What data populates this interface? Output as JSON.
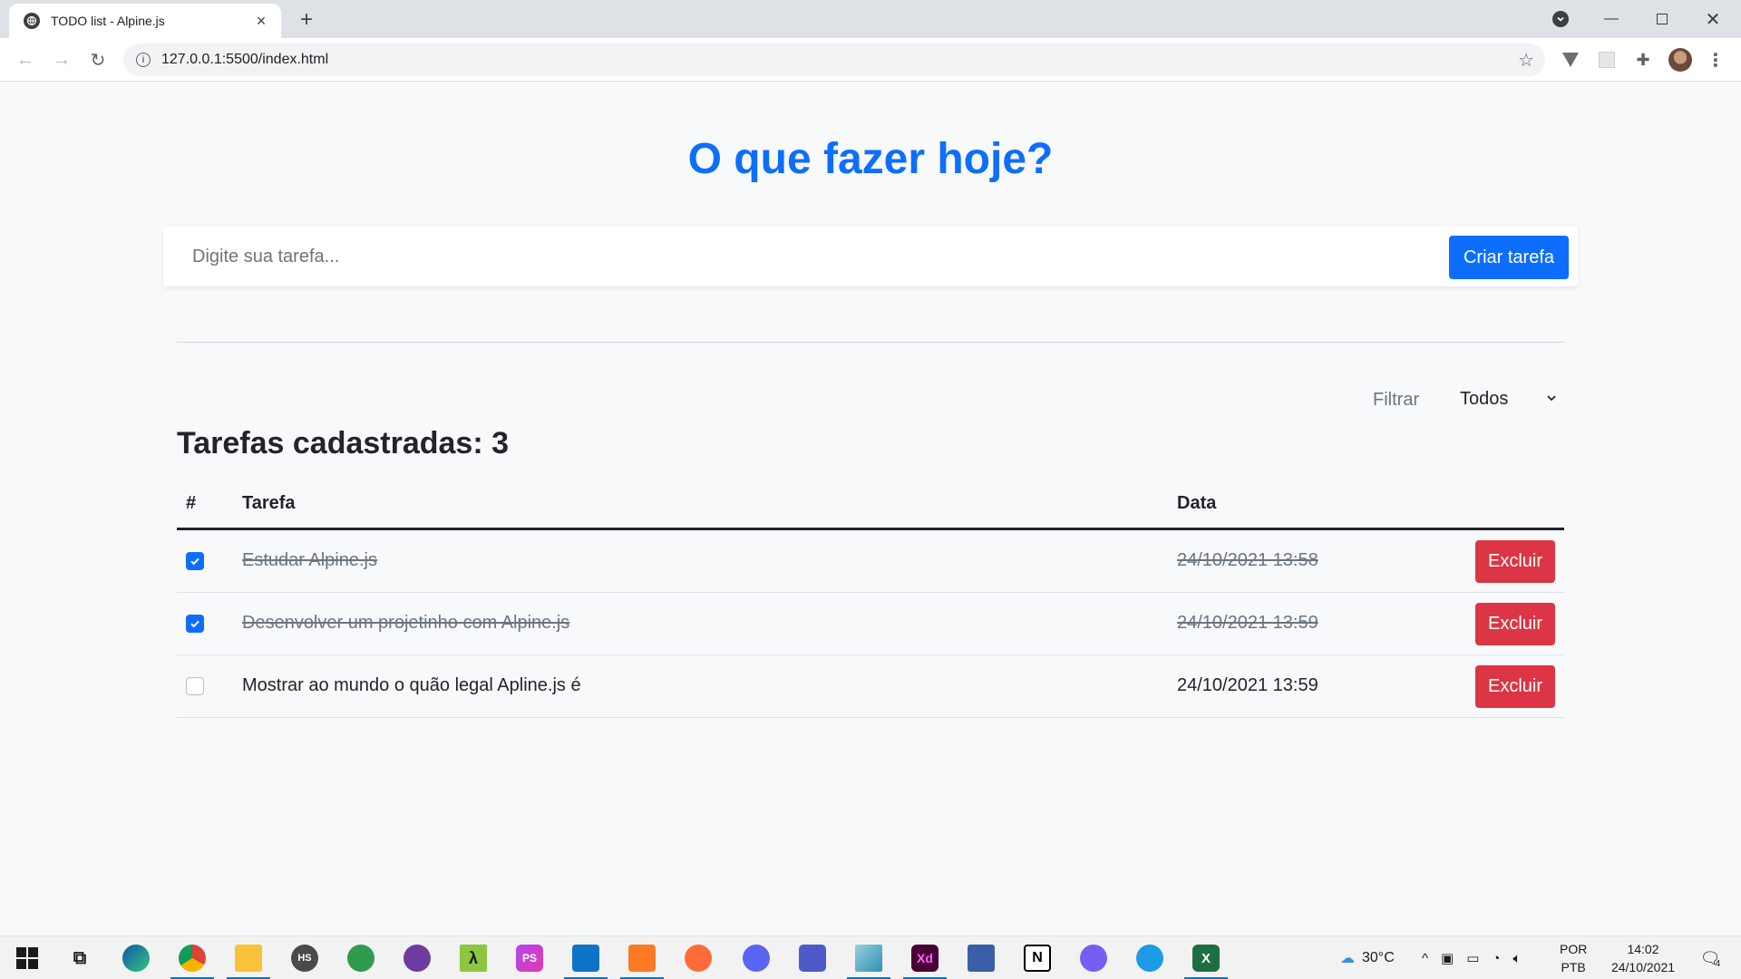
{
  "browser": {
    "tab_title": "TODO list - Alpine.js",
    "url": "127.0.0.1:5500/index.html"
  },
  "page": {
    "title": "O que fazer hoje?",
    "input_placeholder": "Digite sua tarefa...",
    "input_value": "",
    "create_button": "Criar tarefa",
    "filter_label": "Filtrar",
    "filter_value": "Todos",
    "count_heading": "Tarefas cadastradas: 3",
    "table": {
      "headers": [
        "#",
        "Tarefa",
        "Data"
      ],
      "rows": [
        {
          "checked": true,
          "task": "Estudar Alpine.js",
          "date": "24/10/2021 13:58",
          "delete": "Excluir"
        },
        {
          "checked": true,
          "task": "Desenvolver um projetinho com Alpine.js",
          "date": "24/10/2021 13:59",
          "delete": "Excluir"
        },
        {
          "checked": false,
          "task": "Mostrar ao mundo o quão legal Apline.js é",
          "date": "24/10/2021 13:59",
          "delete": "Excluir"
        }
      ]
    }
  },
  "colors": {
    "primary": "#0d6efd",
    "danger": "#dc3545",
    "page_bg": "#f8f9fa"
  },
  "taskbar": {
    "apps": [
      "windows-start",
      "task-view",
      "edge",
      "chrome",
      "file-explorer",
      "hs-app",
      "green-app",
      "github-desktop",
      "lambda-app",
      "phpstorm",
      "vscode",
      "xampp",
      "postman",
      "discord",
      "teams",
      "notepad-app",
      "adobe-xd",
      "network-app",
      "notion",
      "viber",
      "docker",
      "excel"
    ],
    "apps_labels": {
      "hs": "HS",
      "lambda": "λ",
      "phpstorm": "PS",
      "xd": "Xd",
      "notion": "N",
      "excel": "X"
    },
    "weather": "30°C",
    "lang_top": "POR",
    "lang_bottom": "PTB",
    "time": "14:02",
    "date": "24/10/2021",
    "notification_count": "4"
  }
}
